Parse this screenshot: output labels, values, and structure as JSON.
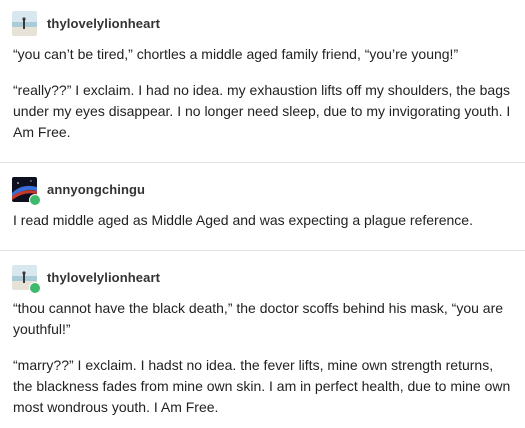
{
  "posts": [
    {
      "username": "thylovelylionheart",
      "avatar_icon": "beach-figure-avatar",
      "reblogged": false,
      "paragraphs": [
        "“you can’t be tired,” chortles a middle aged family friend, “you’re young!”",
        "“really??” I exclaim. I had no idea. my exhaustion lifts off my shoulders, the bags under my eyes disappear. I no longer need sleep, due to my invigorating youth. I Am Free."
      ]
    },
    {
      "username": "annyongchingu",
      "avatar_icon": "space-planet-avatar",
      "reblogged": true,
      "paragraphs": [
        "I read middle aged as Middle Aged and was expecting a plague reference."
      ]
    },
    {
      "username": "thylovelylionheart",
      "avatar_icon": "beach-figure-avatar",
      "reblogged": true,
      "paragraphs": [
        "“thou cannot have the black death,” the doctor scoffs behind his mask, “you are youthful!”",
        "“marry??” I exclaim. I hadst no idea. the fever lifts, mine own strength returns, the blackness fades from mine own skin. I am in perfect health, due to mine own most wondrous youth. I Am Free."
      ]
    }
  ],
  "colors": {
    "text": "#222222",
    "divider": "#e3e3e3",
    "reblog_badge": "#3fb96b"
  }
}
